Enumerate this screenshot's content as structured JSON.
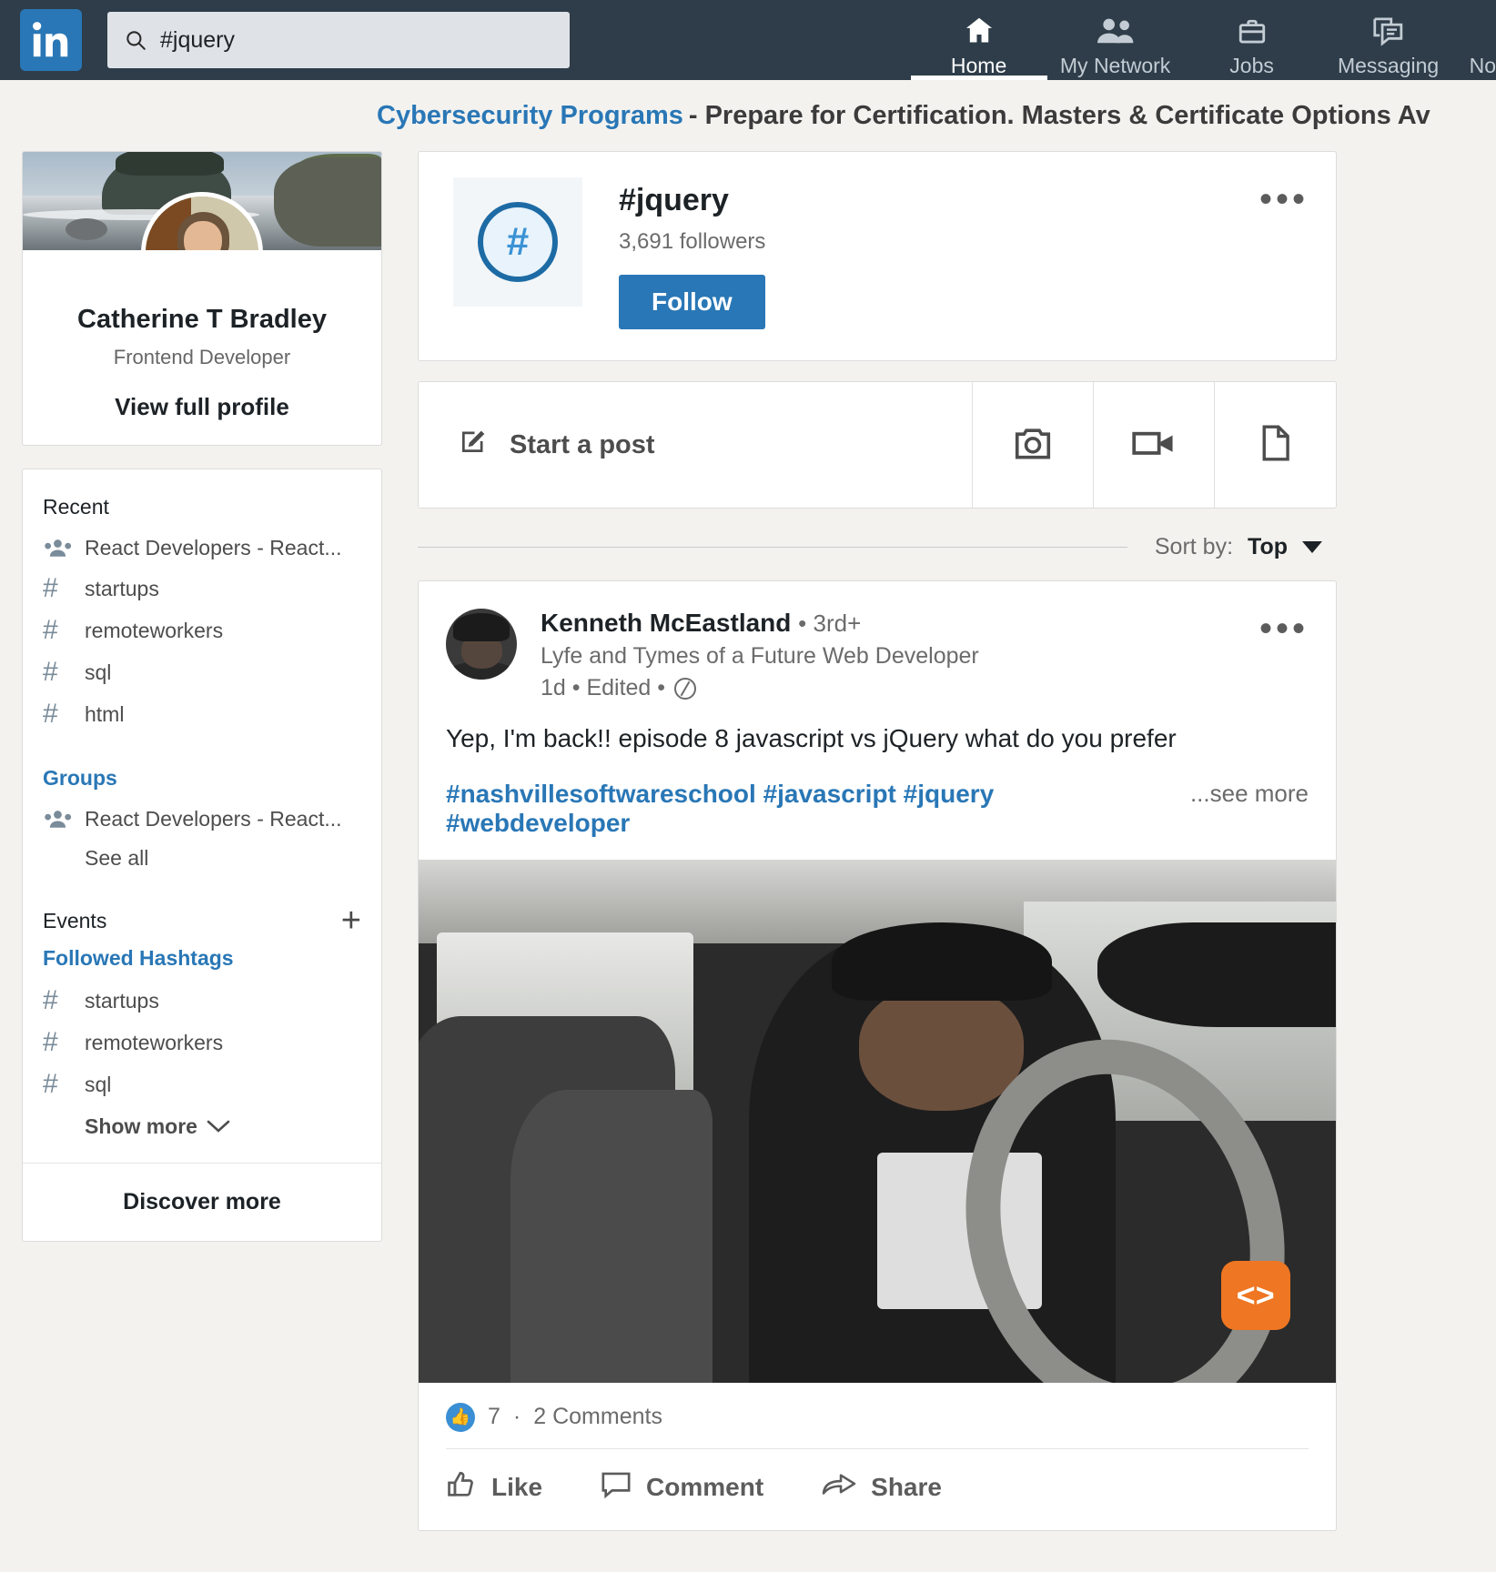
{
  "nav": {
    "logo_alt": "linkedin-logo",
    "search": {
      "value": "#jquery",
      "placeholder": "Search"
    },
    "items": [
      {
        "label": "Home",
        "icon": "home-icon",
        "active": true
      },
      {
        "label": "My Network",
        "icon": "network-icon",
        "active": false
      },
      {
        "label": "Jobs",
        "icon": "briefcase-icon",
        "active": false
      },
      {
        "label": "Messaging",
        "icon": "messaging-icon",
        "active": false
      },
      {
        "label": "No",
        "icon": "notifications-icon",
        "active": false
      }
    ]
  },
  "promo": {
    "link_text": "Cybersecurity Programs",
    "rest_text": "- Prepare for Certification. Masters & Certificate Options Av"
  },
  "profile": {
    "name": "Catherine T Bradley",
    "headline": "Frontend Developer",
    "view_full_profile": "View full profile"
  },
  "sidebar": {
    "recent_header": "Recent",
    "recent_items": [
      {
        "label": "React Developers - React...",
        "icon": "group-icon"
      },
      {
        "label": "startups",
        "icon": "hash-icon"
      },
      {
        "label": "remoteworkers",
        "icon": "hash-icon"
      },
      {
        "label": "sql",
        "icon": "hash-icon"
      },
      {
        "label": "html",
        "icon": "hash-icon"
      }
    ],
    "groups_header": "Groups",
    "groups_items": [
      {
        "label": "React Developers - React...",
        "icon": "group-icon"
      }
    ],
    "see_all": "See all",
    "events_header": "Events",
    "events_add": "+",
    "hashtags_header": "Followed Hashtags",
    "hashtag_items": [
      {
        "label": "startups",
        "icon": "hash-icon"
      },
      {
        "label": "remoteworkers",
        "icon": "hash-icon"
      },
      {
        "label": "sql",
        "icon": "hash-icon"
      }
    ],
    "show_more": "Show more",
    "discover_more": "Discover more"
  },
  "hashtag_page": {
    "icon": "hash-icon",
    "title": "#jquery",
    "followers": "3,691 followers",
    "follow_label": "Follow",
    "more_menu": "•••"
  },
  "composer": {
    "start_post_label": "Start a post",
    "actions": [
      {
        "name": "photo-icon"
      },
      {
        "name": "video-icon"
      },
      {
        "name": "document-icon"
      }
    ]
  },
  "sort": {
    "label": "Sort by:",
    "value": "Top"
  },
  "post": {
    "author": "Kenneth McEastland",
    "degree": "• 3rd+",
    "headline": "Lyfe and Tymes of a Future Web Developer",
    "time": "1d • Edited •",
    "visibility_icon": "globe-icon",
    "more_menu": "•••",
    "text": "Yep, I'm back!!   episode 8 javascript vs jQuery what do you prefer",
    "hashtags": "#nashvillesoftwareschool #javascript #jquery #webdeveloper",
    "see_more": "...see more",
    "media_badge": "<>",
    "reactions_count": "7",
    "reactions_sep": "·",
    "comments_count": "2 Comments",
    "actions": [
      {
        "label": "Like",
        "icon": "thumbs-up-icon"
      },
      {
        "label": "Comment",
        "icon": "comment-icon"
      },
      {
        "label": "Share",
        "icon": "share-icon"
      }
    ]
  },
  "colors": {
    "nav_bg": "#2e3d49",
    "brand_blue": "#2977b6",
    "page_bg": "#f3f2ef",
    "hash_gray": "#7a8b99"
  }
}
